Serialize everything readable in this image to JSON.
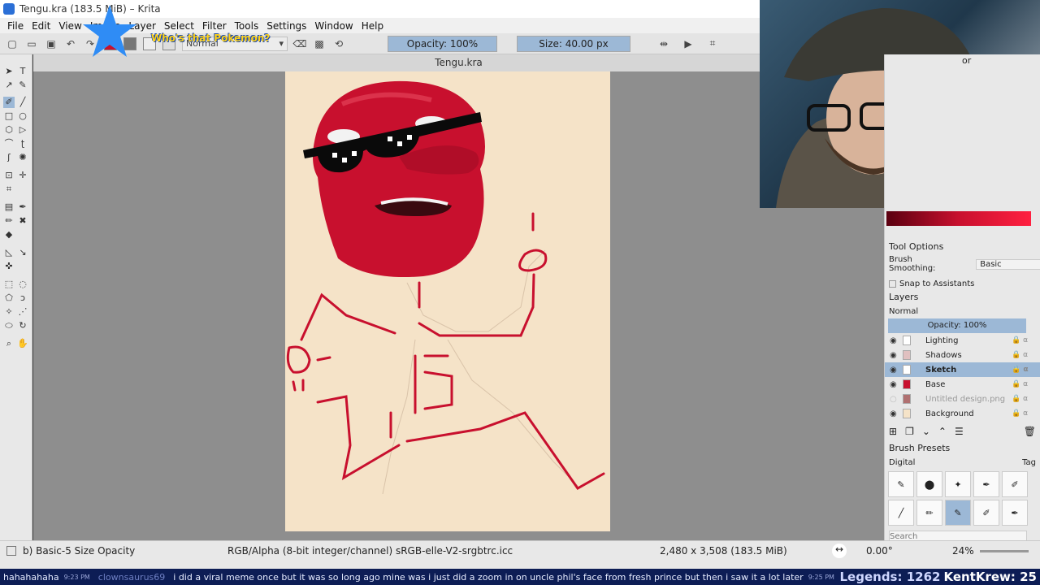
{
  "window": {
    "title": "Tengu.kra (183.5 MiB) – Krita",
    "controls": [
      "—",
      "❐",
      "✕"
    ]
  },
  "menu": [
    "File",
    "Edit",
    "View",
    "Image",
    "Layer",
    "Select",
    "Filter",
    "Tools",
    "Settings",
    "Window",
    "Help"
  ],
  "toolbar": {
    "blend_mode": "Normal",
    "opacity_label": "Opacity: 100%",
    "size_label": "Size: 40.00 px"
  },
  "overlay": {
    "pokemon_text": "Who's that Pokemon?"
  },
  "document": {
    "tab_title": "Tengu.kra"
  },
  "colors": {
    "accent": "#9cb8d6",
    "paper": "#f5e3c8",
    "sketch_red": "#c8102e"
  },
  "right_panel": {
    "color_title": "or",
    "tool_options": {
      "title": "Tool Options",
      "smoothing_label": "Brush Smoothing:",
      "smoothing_value": "Basic",
      "snap_label": "Snap to Assistants"
    },
    "layers": {
      "title": "Layers",
      "blend_mode": "Normal",
      "opacity_label": "Opacity:  100%",
      "items": [
        {
          "name": "Lighting"
        },
        {
          "name": "Shadows"
        },
        {
          "name": "Sketch"
        },
        {
          "name": "Base"
        },
        {
          "name": "Untitled design.png"
        },
        {
          "name": "Background"
        }
      ]
    },
    "brush_presets": {
      "title": "Brush Presets",
      "tag_filter": "Digital",
      "tag_label": "Tag",
      "search_placeholder": "Search"
    }
  },
  "statusbar": {
    "brush": "b) Basic-5 Size Opacity",
    "color_model": "RGB/Alpha (8-bit integer/channel)  sRGB-elle-V2-srgbtrc.icc",
    "dimensions": "2,480 x 3,508 (183.5 MiB)",
    "rotation": "0.00°",
    "zoom": "24%"
  },
  "chat": {
    "messages": [
      {
        "text": "hahahahaha",
        "time": "9:23 PM"
      },
      {
        "user": "clownsaurus69",
        "text": "i did a viral meme once but it was so long ago  mine was i just did a zoom in on uncle phil's face from fresh prince  but then i saw it a lot later",
        "time": "9:25 PM"
      }
    ],
    "legends": "Legends: 1262",
    "krew": "KentKrew: 25"
  }
}
